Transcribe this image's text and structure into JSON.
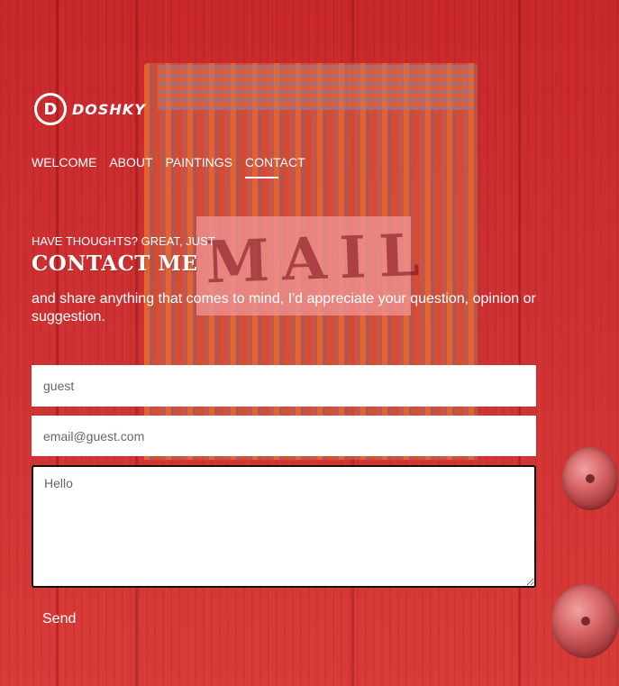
{
  "brand": {
    "logo_letter": "D",
    "name": "DOSHKY"
  },
  "nav": {
    "items": [
      {
        "label": "WELCOME"
      },
      {
        "label": "ABOUT"
      },
      {
        "label": "PAINTINGS"
      },
      {
        "label": "CONTACT"
      }
    ]
  },
  "hero": {
    "eyebrow": "HAVE THOUGHTS? GREAT, JUST",
    "title": "CONTACT ME",
    "intro": "and share anything that comes to mind, I'd appreciate your question, opinion or suggestion.",
    "background_word": "MAIL"
  },
  "form": {
    "name_placeholder": "guest",
    "email_placeholder": "email@guest.com",
    "message_placeholder": "Hello",
    "send_label": "Send"
  },
  "colors": {
    "background": "#c4252a",
    "text": "#ffffff"
  }
}
